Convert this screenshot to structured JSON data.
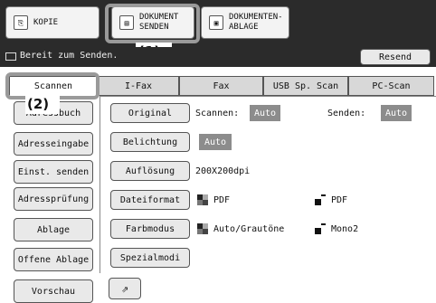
{
  "top_tabs": [
    {
      "label": "KOPIE",
      "icon": "copy-icon"
    },
    {
      "label": "DOKUMENT SENDEN",
      "icon": "document-send-icon"
    },
    {
      "label": "DOKUMENTEN-ABLAGE",
      "icon": "document-filing-icon"
    }
  ],
  "status": {
    "text": "Bereit zum Senden.",
    "icon": "message-icon"
  },
  "resend_label": "Resend",
  "callouts": {
    "one": "(1)",
    "two": "(2)"
  },
  "tabs": [
    "Scannen",
    "I-Fax",
    "Fax",
    "USB Sp. Scan",
    "PC-Scan"
  ],
  "sidebar": [
    {
      "label": "Adressbuch"
    },
    {
      "label": "Adresseingabe"
    },
    {
      "label": "Einst. senden"
    },
    {
      "label": "Adressprüfung"
    },
    {
      "label": "Ablage"
    },
    {
      "label": "Offene Ablage"
    },
    {
      "label": "Vorschau"
    }
  ],
  "settings": {
    "original": {
      "label": "Original",
      "scan_label": "Scannen:",
      "scan_value": "Auto",
      "send_label": "Senden:",
      "send_value": "Auto"
    },
    "exposure": {
      "label": "Belichtung",
      "value": "Auto"
    },
    "resolution": {
      "label": "Auflösung",
      "value": "200X200dpi"
    },
    "file_format": {
      "label": "Dateiformat",
      "left": "PDF",
      "right": "PDF"
    },
    "color_mode": {
      "label": "Farbmodus",
      "left": "Auto/Grautöne",
      "right": "Mono2"
    },
    "special": {
      "label": "Spezialmodi"
    }
  },
  "colors": {
    "topbar": "#2b2b2b",
    "value_bg": "#8c8c8c",
    "callout": "#9a9a9a"
  }
}
